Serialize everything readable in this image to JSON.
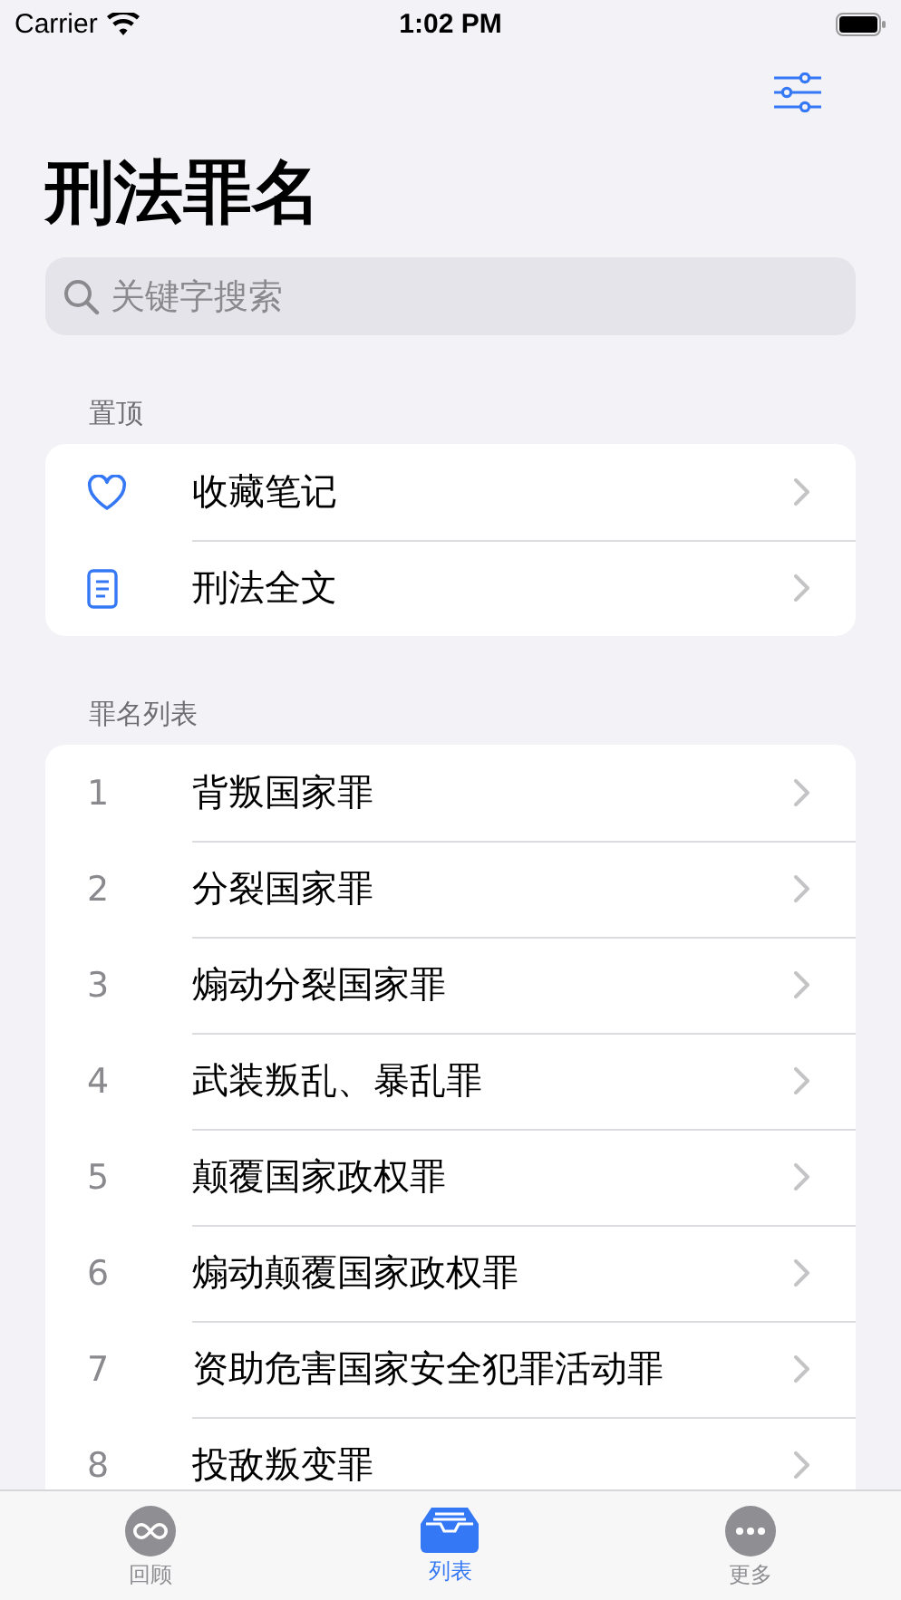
{
  "status_bar": {
    "carrier": "Carrier",
    "time": "1:02 PM"
  },
  "title": "刑法罪名",
  "search": {
    "placeholder": "关键字搜索"
  },
  "pinned": {
    "header": "置顶",
    "items": [
      {
        "kind": "heart",
        "label": "收藏笔记"
      },
      {
        "kind": "document",
        "label": "刑法全文"
      }
    ]
  },
  "crimes": {
    "header": "罪名列表",
    "items": [
      {
        "number": "1",
        "label": "背叛国家罪"
      },
      {
        "number": "2",
        "label": "分裂国家罪"
      },
      {
        "number": "3",
        "label": "煽动分裂国家罪"
      },
      {
        "number": "4",
        "label": "武装叛乱、暴乱罪"
      },
      {
        "number": "5",
        "label": "颠覆国家政权罪"
      },
      {
        "number": "6",
        "label": "煽动颠覆国家政权罪"
      },
      {
        "number": "7",
        "label": "资助危害国家安全犯罪活动罪"
      },
      {
        "number": "8",
        "label": "投敌叛变罪"
      }
    ]
  },
  "tab_bar": [
    {
      "kind": "infinity",
      "label": "回顾",
      "selected": false
    },
    {
      "kind": "tray",
      "label": "列表",
      "selected": true
    },
    {
      "kind": "more",
      "label": "更多",
      "selected": false
    }
  ]
}
